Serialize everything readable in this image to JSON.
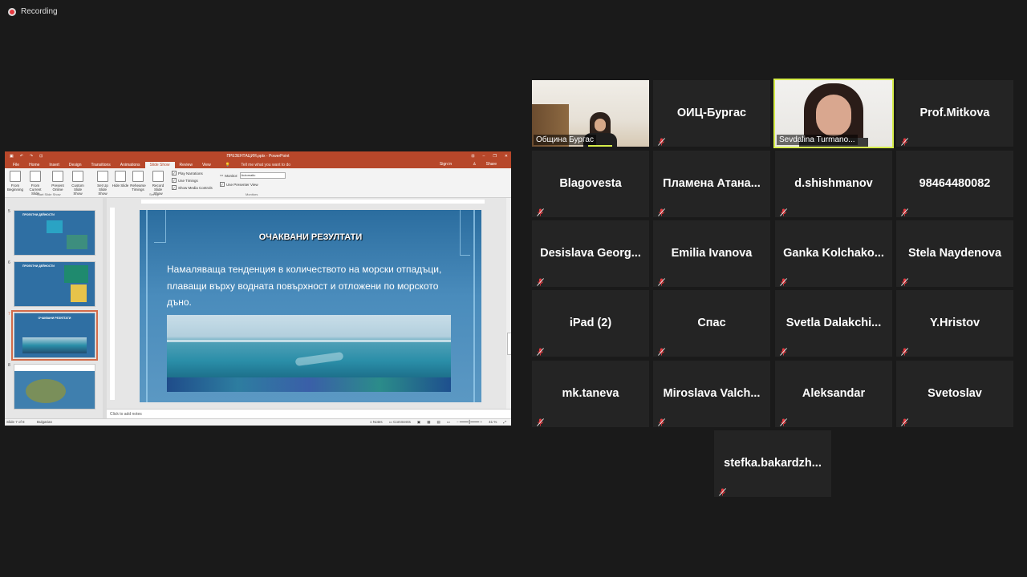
{
  "recording": {
    "label": "Recording"
  },
  "powerpoint": {
    "title": "ПРЕЗЕНТАЦИЯ.pptx - PowerPoint",
    "tabs": [
      "File",
      "Home",
      "Insert",
      "Design",
      "Transitions",
      "Animations",
      "Slide Show",
      "Review",
      "View"
    ],
    "active_tab": "Slide Show",
    "tell_me": "Tell me what you want to do",
    "sign_in": "Sign in",
    "share": "Share",
    "ribbon": {
      "buttons": [
        "From Beginning",
        "From Current Slide",
        "Present Online",
        "Custom Slide Show",
        "Set Up Slide Show",
        "Hide Slide",
        "Rehearse Timings",
        "Record Slide Show"
      ],
      "checkboxes": [
        "Play Narrations",
        "Use Timings",
        "Show Media Controls"
      ],
      "monitor_label": "Monitor:",
      "monitor_value": "Automatic",
      "presenter_view": "Use Presenter View",
      "groups": [
        "Start Slide Show",
        "Set Up",
        "Monitors"
      ]
    },
    "thumbnails": [
      {
        "num": "5",
        "title": "ПРОЕКТНИ ДЕЙНОСТИ"
      },
      {
        "num": "6",
        "title": "ПРОЕКТНИ ДЕЙНОСТИ"
      },
      {
        "num": "7",
        "title": "ОЧАКВАНИ РЕЗУЛТАТИ",
        "selected": true
      },
      {
        "num": "8",
        "title": ""
      }
    ],
    "slide": {
      "title": "ОЧАКВАНИ РЕЗУЛТАТИ",
      "text": "Намаляваща тенденция в количеството на морски отпадъци, плаващи върху водната повърхност и отложени по морското дъно."
    },
    "notes_placeholder": "Click to add notes",
    "status": {
      "slide": "Slide 7 of 8",
      "language": "Bulgarian",
      "notes": "Notes",
      "comments": "Comments",
      "zoom": "41 %"
    }
  },
  "participants": [
    {
      "name": "Община Бургас",
      "video": true
    },
    {
      "name": "ОИЦ-Бургас",
      "video": false
    },
    {
      "name": "Sevdalina Turmano...",
      "video": true,
      "active": true
    },
    {
      "name": "Prof.Mitkova",
      "video": false
    },
    {
      "name": "Blagovesta",
      "video": false
    },
    {
      "name": "Пламена  Атана...",
      "video": false
    },
    {
      "name": "d.shishmanov",
      "video": false
    },
    {
      "name": "98464480082",
      "video": false
    },
    {
      "name": "Desislava  Georg...",
      "video": false
    },
    {
      "name": "Emilia Ivanova",
      "video": false
    },
    {
      "name": "Ganka  Kolchako...",
      "video": false
    },
    {
      "name": "Stela Naydenova",
      "video": false
    },
    {
      "name": "iPad (2)",
      "video": false
    },
    {
      "name": "Спас",
      "video": false
    },
    {
      "name": "Svetla  Dalakchi...",
      "video": false
    },
    {
      "name": "Y.Hristov",
      "video": false
    },
    {
      "name": "mk.taneva",
      "video": false
    },
    {
      "name": "Miroslava  Valch...",
      "video": false
    },
    {
      "name": "Aleksandar",
      "video": false
    },
    {
      "name": "Svetoslav",
      "video": false
    },
    {
      "name": "stefka.bakardzh...",
      "video": false
    }
  ],
  "colors": {
    "ppt_red": "#b7472a",
    "active_speaker": "#d6ed4a",
    "muted": "#e5393f",
    "tile_bg": "#242424"
  }
}
